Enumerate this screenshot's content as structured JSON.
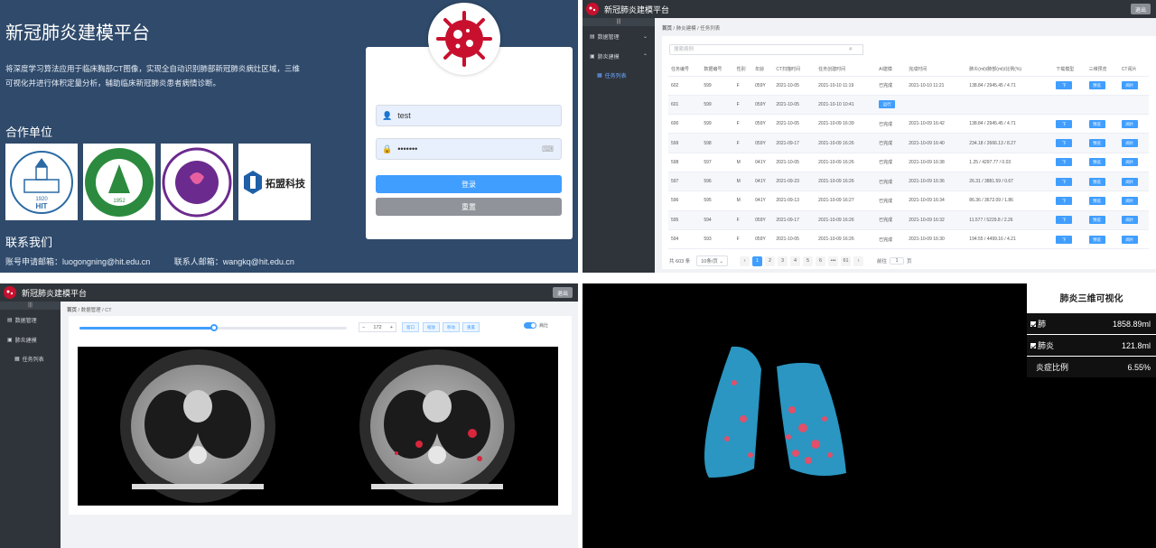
{
  "login": {
    "title": "新冠肺炎建模平台",
    "description": "将深度学习算法应用于临床胸部CT图像，实现全自动识别肺部新冠肺炎病灶区域，三维可视化并进行体积定量分析，辅助临床新冠肺炎患者病情诊断。",
    "partners_heading": "合作单位",
    "partner_logos": [
      "HIT",
      "NORTHEAST FORESTRY UNIVERSITY",
      "哈尔滨医科大学附属第一医院",
      "拓盟科技"
    ],
    "partner_text": {
      "hit_year": "1920",
      "hit_name": "HIT",
      "nefu_year": "1952",
      "tuomeng": "拓盟科技"
    },
    "contact_heading": "联系我们",
    "email_account": "账号申请邮箱：luogongning@hit.edu.cn",
    "email_contact": "联系人邮箱：wangkq@hit.edu.cn",
    "username_value": "test",
    "password_mask": "•••••••",
    "login_button": "登录",
    "reset_button": "重置",
    "colors": {
      "primary": "#409eff",
      "reset": "#909399",
      "bg": "#2f4a6b"
    }
  },
  "app": {
    "title": "新冠肺炎建模平台",
    "exit_label": "退出",
    "grip": "|||",
    "menu": [
      {
        "label": "数据管理"
      },
      {
        "label": "肺炎建模"
      }
    ],
    "submenu": "任务列表"
  },
  "tasks": {
    "breadcrumb": [
      "首页",
      "肺炎建模",
      "任务列表"
    ],
    "search_placeholder": "搜索病例",
    "columns": [
      "任务编号",
      "数据编号",
      "性别",
      "年龄",
      "CT扫描时间",
      "任务创建时间",
      "AI建模",
      "完成时间",
      "肺炎(ml)/肺部(ml)/比例(%)",
      "下载模型",
      "三维预览",
      "CT阅片"
    ],
    "rows": [
      {
        "id": "602",
        "data": "599",
        "sex": "F",
        "age": "059Y",
        "ct": "2021-10-05",
        "created": "2021-10-10 11:19",
        "ai": "已完成",
        "done": "2021-10-10 11:21",
        "vol": "138.84 / 2945.45 / 4.71"
      },
      {
        "id": "601",
        "data": "599",
        "sex": "F",
        "age": "059Y",
        "ct": "2021-10-05",
        "created": "2021-10-10 10:41",
        "ai": "运行",
        "done": "",
        "vol": ""
      },
      {
        "id": "600",
        "data": "599",
        "sex": "F",
        "age": "059Y",
        "ct": "2021-10-05",
        "created": "2021-10-09 16:39",
        "ai": "已完成",
        "done": "2021-10-09 16:42",
        "vol": "138.84 / 2945.45 / 4.71"
      },
      {
        "id": "599",
        "data": "598",
        "sex": "F",
        "age": "059Y",
        "ct": "2021-09-17",
        "created": "2021-10-09 16:26",
        "ai": "已完成",
        "done": "2021-10-09 16:40",
        "vol": "234.18 / 2666.13 / 8.27"
      },
      {
        "id": "598",
        "data": "597",
        "sex": "M",
        "age": "041Y",
        "ct": "2021-10-05",
        "created": "2021-10-09 16:26",
        "ai": "已完成",
        "done": "2021-10-09 16:38",
        "vol": "1.25 / 4297.77 / 0.03"
      },
      {
        "id": "597",
        "data": "596",
        "sex": "M",
        "age": "041Y",
        "ct": "2021-09-23",
        "created": "2021-10-09 16:26",
        "ai": "已完成",
        "done": "2021-10-09 16:36",
        "vol": "26.31 / 3881.59 / 0.67"
      },
      {
        "id": "596",
        "data": "595",
        "sex": "M",
        "age": "041Y",
        "ct": "2021-09-13",
        "created": "2021-10-09 16:27",
        "ai": "已完成",
        "done": "2021-10-09 16:34",
        "vol": "86.36 / 3672.09 / 1.86"
      },
      {
        "id": "595",
        "data": "594",
        "sex": "F",
        "age": "059Y",
        "ct": "2021-09-17",
        "created": "2021-10-09 16:26",
        "ai": "已完成",
        "done": "2021-10-09 16:32",
        "vol": "11.577 / 5229.8 / 2.26"
      },
      {
        "id": "594",
        "data": "593",
        "sex": "F",
        "age": "059Y",
        "ct": "2021-10-05",
        "created": "2021-10-09 16:26",
        "ai": "已完成",
        "done": "2021-10-09 16:30",
        "vol": "194.55 / 4499.16 / 4.21"
      }
    ],
    "actions": {
      "download": "下",
      "preview": "预览",
      "read": "阅片"
    },
    "pager": {
      "total": "共 603 条",
      "page_size": "10条/页",
      "pages": [
        "1",
        "2",
        "3",
        "4",
        "5",
        "6",
        "•••",
        "61"
      ],
      "goto": "前往",
      "goto_value": "1",
      "page_suffix": "页"
    }
  },
  "ct": {
    "breadcrumb": [
      "首页",
      "数据管理",
      "CT"
    ],
    "slice_value": "172",
    "slider_fraction": 0.51,
    "tools": [
      "窗口",
      "缩放",
      "移动",
      "重置"
    ],
    "toggle_label": "病灶",
    "minus": "−",
    "plus": "+"
  },
  "viz3d": {
    "title": "肺炎三维可视化",
    "rows": [
      {
        "label": "肺",
        "value": "1858.89ml"
      },
      {
        "label": "肺炎",
        "value": "121.8ml"
      },
      {
        "label": "炎症比例",
        "value": "6.55%"
      }
    ]
  }
}
